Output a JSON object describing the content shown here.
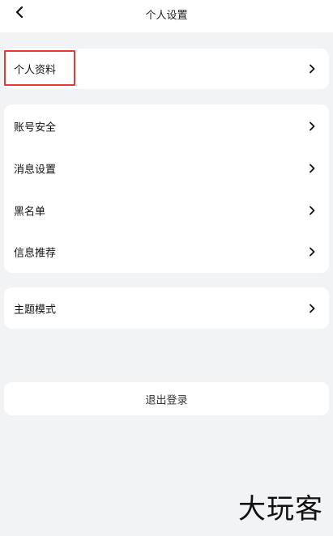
{
  "header": {
    "title": "个人设置",
    "back_icon": "chevron-left-icon"
  },
  "groups": [
    {
      "items": [
        {
          "label": "个人资料",
          "icon": "chevron-right-icon",
          "highlighted": true
        }
      ]
    },
    {
      "items": [
        {
          "label": "账号安全",
          "icon": "chevron-right-icon"
        },
        {
          "label": "消息设置",
          "icon": "chevron-right-icon"
        },
        {
          "label": "黑名单",
          "icon": "chevron-right-icon"
        },
        {
          "label": "信息推荐",
          "icon": "chevron-right-icon"
        }
      ]
    },
    {
      "items": [
        {
          "label": "主题模式",
          "icon": "chevron-right-icon"
        }
      ]
    }
  ],
  "logout": {
    "label": "退出登录"
  },
  "watermark": {
    "text": "大玩客"
  },
  "colors": {
    "background": "#f2f3f5",
    "card": "#ffffff",
    "highlight": "#e53935",
    "text": "#111111"
  }
}
